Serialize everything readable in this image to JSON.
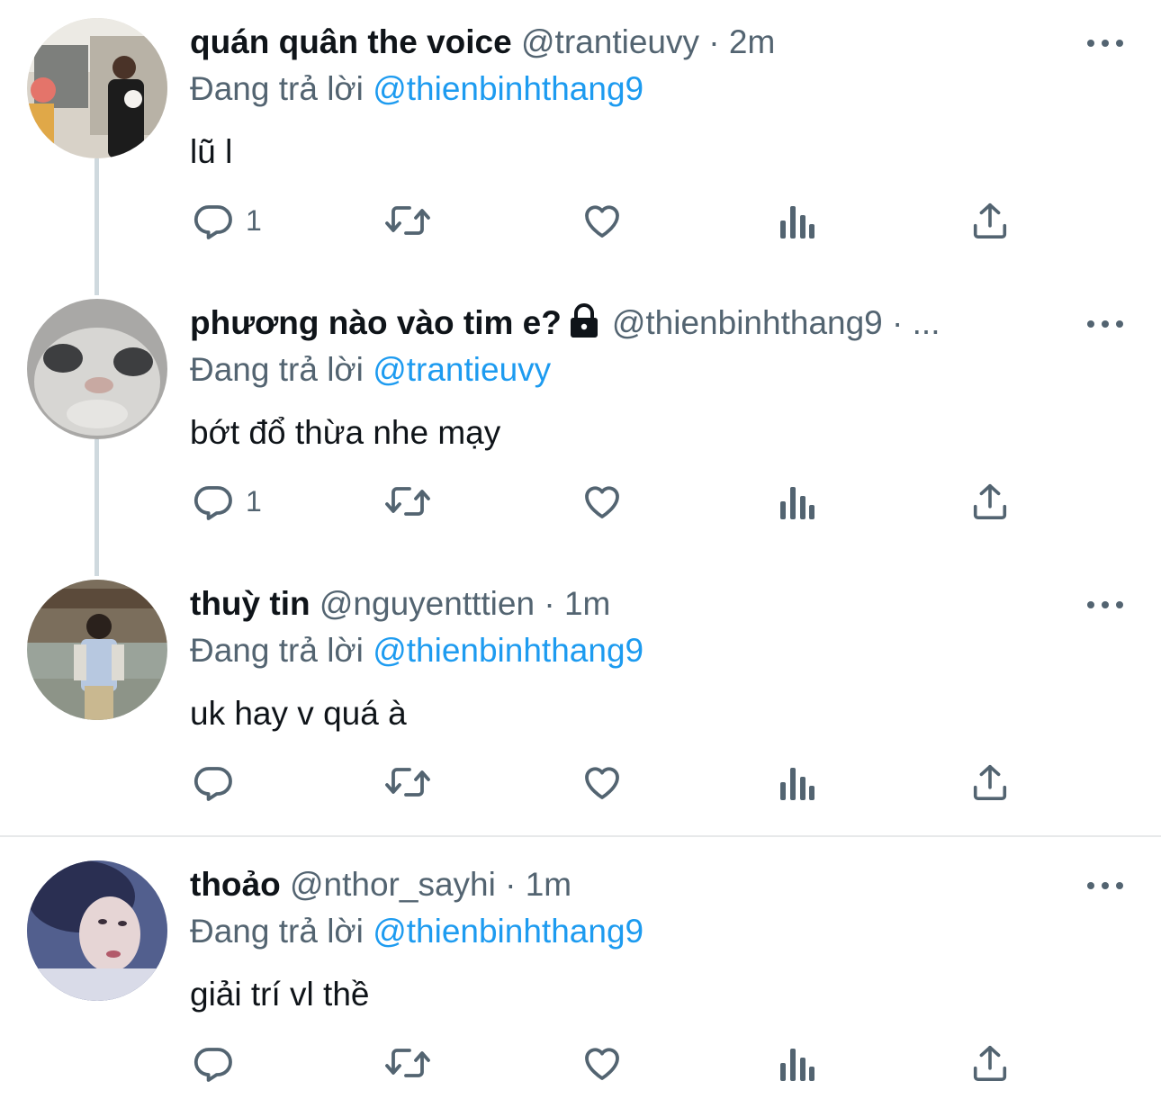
{
  "reply_prefix": "Đang trả lời",
  "tweets": [
    {
      "name": "quán quân the voice",
      "handle": "@trantieuvy",
      "dot": "·",
      "time": "2m",
      "reply_to": "@thienbinhthang9",
      "text": "lũ l",
      "reply_count": "1",
      "locked": false
    },
    {
      "name": "phương nào vào tim e?",
      "handle": "@thienbinhthang9",
      "dot": "·",
      "time": "...",
      "reply_to": "@trantieuvy",
      "text": "bớt đổ thừa nhe mạy",
      "reply_count": "1",
      "locked": true
    },
    {
      "name": "thuỳ tin",
      "handle": "@nguyentttien",
      "dot": "·",
      "time": "1m",
      "reply_to": "@thienbinhthang9",
      "text": "uk hay v quá à",
      "reply_count": "",
      "locked": false
    },
    {
      "name": "thoảo",
      "handle": "@nthor_sayhi",
      "dot": "·",
      "time": "1m",
      "reply_to": "@thienbinhthang9",
      "text": "giải trí vl thề",
      "reply_count": "",
      "locked": false
    }
  ],
  "icons": {
    "reply": "reply-icon",
    "retweet": "retweet-icon",
    "like": "heart-icon",
    "views": "views-icon",
    "share": "share-icon",
    "more": "more-icon",
    "lock": "lock-icon"
  },
  "colors": {
    "mention": "#1d9bf0",
    "secondary": "#536471",
    "thread_line": "#cfd9de"
  }
}
